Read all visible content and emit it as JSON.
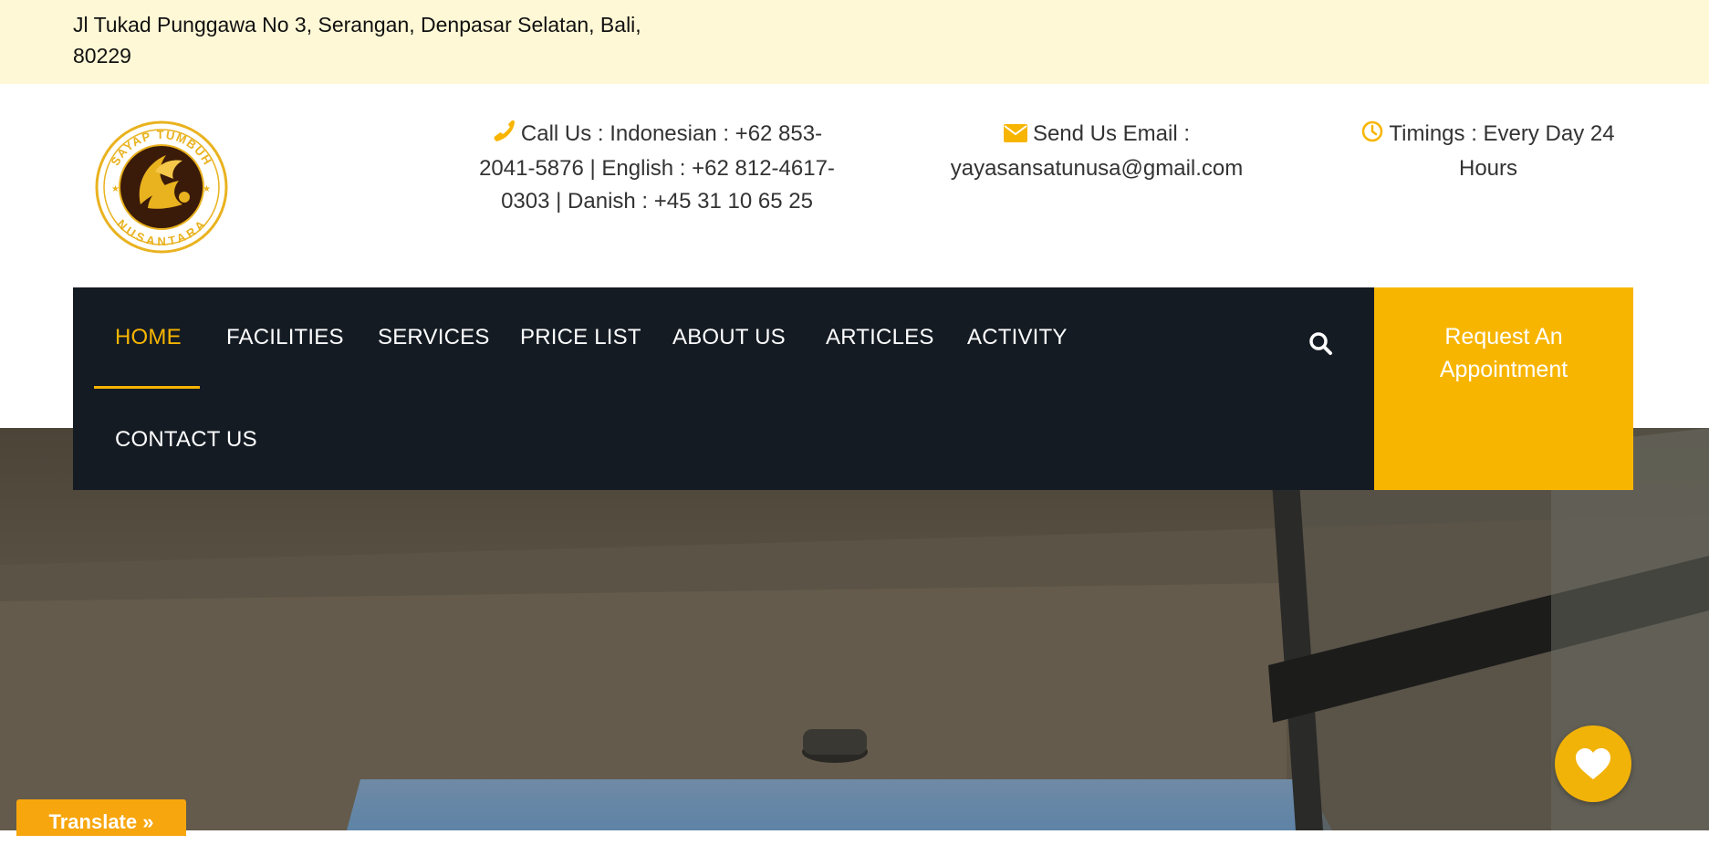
{
  "topbar": {
    "address": "Jl Tukad Punggawa No 3, Serangan, Denpasar Selatan, Bali, 80229"
  },
  "logo": {
    "top_text": "SAYAP TUMBUH",
    "bottom_text": "NUSANTARA"
  },
  "contacts": {
    "call": {
      "icon": "phone-icon",
      "text": "Call Us : Indonesian : +62 853-2041-5876 | English : +62 812-4617-0303 | Danish : +45 31 10 65 25"
    },
    "email": {
      "icon": "envelope-icon",
      "text": "Send Us Email : yayasansatunusa@gmail.com"
    },
    "timings": {
      "icon": "clock-icon",
      "text": "Timings : Every Day 24 Hours"
    }
  },
  "nav": {
    "items": [
      {
        "label": "HOME"
      },
      {
        "label": "FACILITIES"
      },
      {
        "label": "SERVICES"
      },
      {
        "label": "PRICE LIST"
      },
      {
        "label": "ABOUT US"
      },
      {
        "label": "ARTICLES"
      },
      {
        "label": "ACTIVITY"
      },
      {
        "label": "CONTACT US"
      }
    ],
    "active": "HOME",
    "appointment_label": "Request An Appointment"
  },
  "widgets": {
    "translate_label": "Translate »"
  },
  "colors": {
    "accent": "#f7b500",
    "nav_bg": "#141b23",
    "topbar_bg": "#fff8d6"
  }
}
